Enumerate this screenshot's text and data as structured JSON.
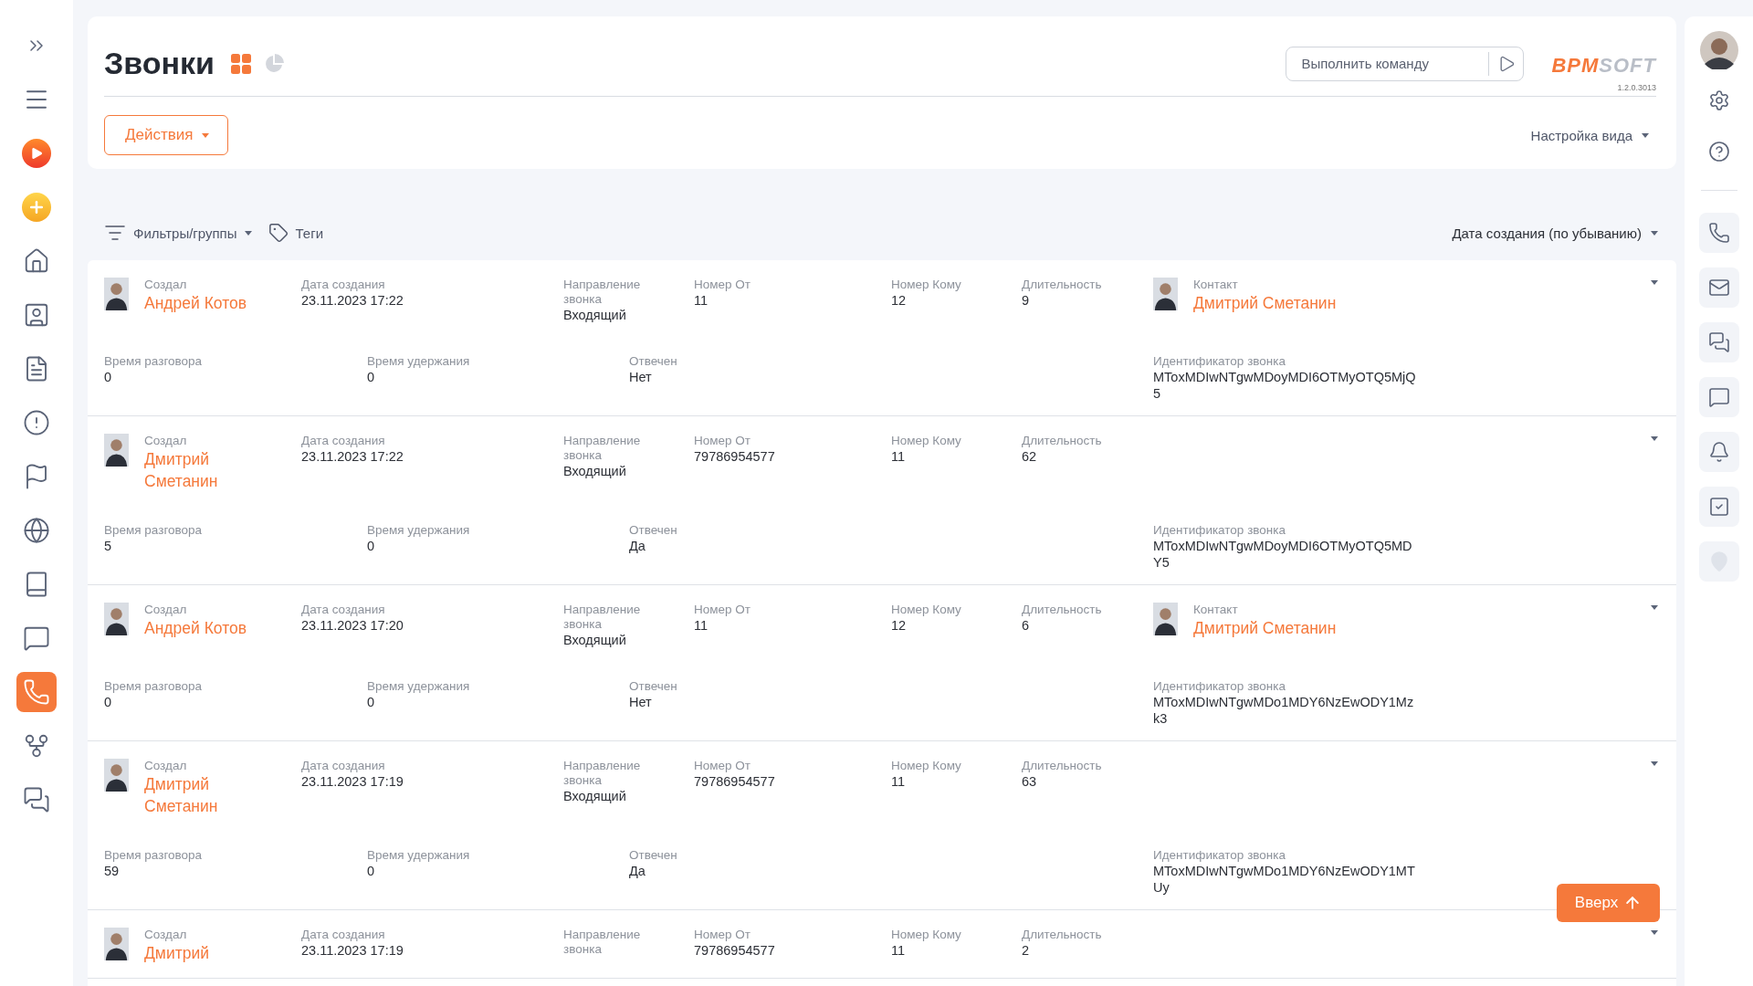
{
  "sidebar": {
    "items": [
      {
        "kind": "expand",
        "selected": false
      },
      {
        "kind": "menu",
        "selected": false
      },
      {
        "kind": "play",
        "selected": false
      },
      {
        "kind": "add",
        "selected": false
      },
      {
        "kind": "home",
        "selected": false
      },
      {
        "kind": "contact",
        "selected": false
      },
      {
        "kind": "document",
        "selected": false
      },
      {
        "kind": "alert",
        "selected": false
      },
      {
        "kind": "flag",
        "selected": false
      },
      {
        "kind": "globe-user",
        "selected": false
      },
      {
        "kind": "book",
        "selected": false
      },
      {
        "kind": "chat",
        "selected": false
      },
      {
        "kind": "phone",
        "selected": true
      },
      {
        "kind": "process",
        "selected": false
      },
      {
        "kind": "chats",
        "selected": false
      }
    ]
  },
  "header": {
    "title": "Звонки",
    "views": [
      {
        "kind": "grid",
        "selected": true
      },
      {
        "kind": "chart",
        "selected": false
      }
    ],
    "command": {
      "placeholder": "Выполнить команду"
    },
    "logo": {
      "accent": "BPM",
      "rest": "SOFT"
    },
    "version": "1.2.0.3013",
    "actions": "Действия",
    "view_settings": "Настройка вида"
  },
  "toolbar": {
    "filters": "Фильтры/группы",
    "tags": "Теги",
    "sort": "Дата создания (по убыванию)"
  },
  "records": [
    {
      "creator": {
        "label": "Создал",
        "name": "Андрей Котов"
      },
      "fields": [
        {
          "label": "Дата создания",
          "value": "23.11.2023 17:22"
        },
        {
          "label": "Направление звонка",
          "value": "Входящий"
        },
        {
          "label": "Номер От",
          "value": "11"
        },
        {
          "label": "Номер Кому",
          "value": "12"
        },
        {
          "label": "Длительность",
          "value": "9"
        }
      ],
      "contact": {
        "label": "Контакт",
        "name": "Дмитрий Сметанин"
      },
      "details": [
        {
          "label": "Время разговора",
          "value": "0"
        },
        {
          "label": "Время удержания",
          "value": "0"
        },
        {
          "label": "Отвечен",
          "value": "Нет"
        },
        {
          "label": "Идентификатор звонка",
          "value": "MToxMDIwNTgwMDoyMDI6OTMyOTQ5MjQ5"
        }
      ]
    },
    {
      "creator": {
        "label": "Создал",
        "name": "Дмитрий Сметанин"
      },
      "fields": [
        {
          "label": "Дата создания",
          "value": "23.11.2023 17:22"
        },
        {
          "label": "Направление звонка",
          "value": "Входящий"
        },
        {
          "label": "Номер От",
          "value": "79786954577"
        },
        {
          "label": "Номер Кому",
          "value": "11"
        },
        {
          "label": "Длительность",
          "value": "62"
        }
      ],
      "details": [
        {
          "label": "Время разговора",
          "value": "5"
        },
        {
          "label": "Время удержания",
          "value": "0"
        },
        {
          "label": "Отвечен",
          "value": "Да"
        },
        {
          "label": "Идентификатор звонка",
          "value": "MToxMDIwNTgwMDoyMDI6OTMyOTQ5MDY5"
        }
      ]
    },
    {
      "creator": {
        "label": "Создал",
        "name": "Андрей Котов"
      },
      "fields": [
        {
          "label": "Дата создания",
          "value": "23.11.2023 17:20"
        },
        {
          "label": "Направление звонка",
          "value": "Входящий"
        },
        {
          "label": "Номер От",
          "value": "11"
        },
        {
          "label": "Номер Кому",
          "value": "12"
        },
        {
          "label": "Длительность",
          "value": "6"
        }
      ],
      "contact": {
        "label": "Контакт",
        "name": "Дмитрий Сметанин"
      },
      "details": [
        {
          "label": "Время разговора",
          "value": "0"
        },
        {
          "label": "Время удержания",
          "value": "0"
        },
        {
          "label": "Отвечен",
          "value": "Нет"
        },
        {
          "label": "Идентификатор звонка",
          "value": "MToxMDIwNTgwMDo1MDY6NzEwODY1Mzk3"
        }
      ]
    },
    {
      "creator": {
        "label": "Создал",
        "name": "Дмитрий Сметанин"
      },
      "fields": [
        {
          "label": "Дата создания",
          "value": "23.11.2023 17:19"
        },
        {
          "label": "Направление звонка",
          "value": "Входящий"
        },
        {
          "label": "Номер От",
          "value": "79786954577"
        },
        {
          "label": "Номер Кому",
          "value": "11"
        },
        {
          "label": "Длительность",
          "value": "63"
        }
      ],
      "details": [
        {
          "label": "Время разговора",
          "value": "59"
        },
        {
          "label": "Время удержания",
          "value": "0"
        },
        {
          "label": "Отвечен",
          "value": "Да"
        },
        {
          "label": "Идентификатор звонка",
          "value": "MToxMDIwNTgwMDo1MDY6NzEwODY1MTUy"
        }
      ]
    },
    {
      "creator": {
        "label": "Создал",
        "name": "Дмитрий"
      },
      "fields": [
        {
          "label": "Дата создания",
          "value": "23.11.2023 17:19"
        },
        {
          "label": "Направление звонка"
        },
        {
          "label": "Номер От",
          "value": "79786954577"
        },
        {
          "label": "Номер Кому",
          "value": "11"
        },
        {
          "label": "Длительность",
          "value": "2"
        }
      ]
    }
  ],
  "scroll_top": "Вверх",
  "right_panel": {
    "items": [
      {
        "kind": "settings",
        "disabled": false
      },
      {
        "kind": "help",
        "disabled": false
      },
      {
        "kind": "phone",
        "disabled": false
      },
      {
        "kind": "mail",
        "disabled": false
      },
      {
        "kind": "chats",
        "disabled": false
      },
      {
        "kind": "chat",
        "disabled": false
      },
      {
        "kind": "bell",
        "disabled": false
      },
      {
        "kind": "task",
        "disabled": false
      },
      {
        "kind": "location",
        "disabled": true
      }
    ]
  }
}
